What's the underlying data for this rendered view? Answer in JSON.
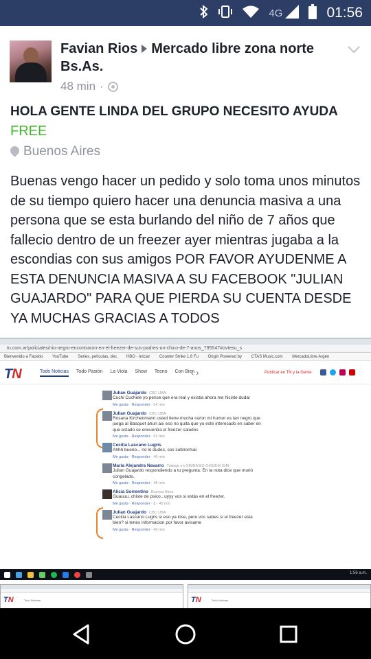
{
  "status_bar": {
    "network": "4G",
    "time": "01:56",
    "icons": [
      "bluetooth-icon",
      "vibrate-icon",
      "wifi-icon",
      "signal-icon",
      "battery-icon"
    ]
  },
  "post": {
    "author": "Favian Rios",
    "group": "Mercado libre zona norte Bs.As.",
    "time": "48 min",
    "title": "HOLA GENTE LINDA DEL GRUPO NECESITO AYUDA",
    "price": "FREE",
    "location": "Buenos Aires",
    "body": "Buenas vengo hacer un pedido y solo toma unos minutos de su tiempo quiero hacer una denuncia masiva a una persona que se esta burlando del niño de 7 años que fallecio dentro de un freezer ayer mientras jugaba a la escondias con sus amigos POR FAVOR AYUDENME A ESTA DENUNCIA MASIVA A SU FACEBOOK \"JULIAN GUAJARDO\" PARA QUE PIERDA SU CUENTA DESDE YA MUCHAS GRACIAS A TODOS",
    "colors": {
      "price": "#42b72a",
      "meta": "#90949c",
      "status_bar": "#2c3d66"
    }
  },
  "screenshot": {
    "url": "tn.com.ar/policiales/nio-negro-encontraron-en-el-freezer-de-sus-padres-un-chico-de-7-anos_795547#ovtesu_s",
    "bookmarks": [
      "Bienvenido a Facebo",
      "YouTube",
      "Series, películas, dec",
      "HBO - Iniciar",
      "Counter Strike 1.6 Fu",
      "Origin Powered by",
      "CTAS Music.com",
      "MercadoLibre Argen"
    ],
    "logo_a": "T",
    "logo_b": "N",
    "menu": [
      "Todo Noticias",
      "Todo Pasión",
      "La Viola",
      "Show",
      "Tecno",
      "Con Bien"
    ],
    "arrows": "‹   ›",
    "publish": "Publicar en TN y la Gente",
    "comments": [
      {
        "name": "Julian Guajardo",
        "work": "CBC UBA",
        "text": "Cuchi Cuchele yo pense que era real y existia ahora me hiciste dudar",
        "actions": "Me gusta · Responder ·",
        "time": "54 min"
      },
      {
        "name": "Julian Guajardo",
        "work": "CBC UBA",
        "text": "Rosana Kirchenmann usted tiene mucha razon mi humor es tan negro que juega al Basquet ahun asi eso no quita que yo este interesado en saber en que estado se encuentra el freezer saludos",
        "actions": "Me gusta · Responder ·",
        "time": "53 min"
      },
      {
        "name": "Cecilia Lascano Lugris",
        "work": "",
        "text": "Ahhh bueno... no lo dudes, sos subnormal.",
        "actions": "Me gusta · Responder ·",
        "time": "46 min"
      },
      {
        "name": "María Alejandra Navarro",
        "work": "Trabaja en GIMNASIO OXIGEM GIM",
        "text": "Julian Guajardo respondiendo a tu pregunta. En la nota dice que murió congelado.",
        "actions": "Me gusta · Responder ·",
        "time": "48 min"
      },
      {
        "name": "Alicia Sorrentino",
        "work": "Buenos Aires",
        "text": "Guauuu..chiste de psico...uyyy vos si estás en el freezer.",
        "actions": "Me gusta · Responder · 1 ·",
        "time": "45 min"
      },
      {
        "name": "Julian Guajardo",
        "work": "CBC UBA",
        "text": "Cecilia Lascano Lugris si eso ya lose, pero vos sabes si el freezer esta bien? si tenes informacion por favor avisame",
        "actions": "Me gusta · Responder ·",
        "time": "45 min"
      }
    ],
    "taskbar_time": "1:56 a.m."
  },
  "nav": {
    "icons": [
      "back-icon",
      "home-icon",
      "recents-icon"
    ]
  }
}
